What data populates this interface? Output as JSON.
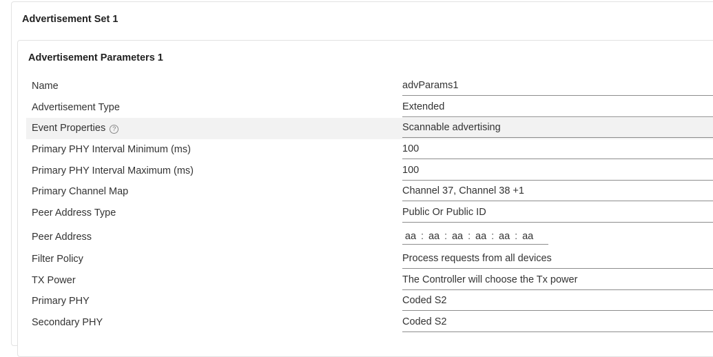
{
  "advertisement_set": {
    "title": "Advertisement Set 1",
    "params_panel": {
      "title": "Advertisement Parameters 1",
      "fields": [
        {
          "label": "Name",
          "value": "advParams1"
        },
        {
          "label": "Advertisement Type",
          "value": "Extended"
        },
        {
          "label": "Event Properties",
          "value": "Scannable advertising",
          "help_icon": "help-circle-icon",
          "highlighted": true
        },
        {
          "label": "Primary PHY Interval Minimum (ms)",
          "value": "100"
        },
        {
          "label": "Primary PHY Interval Maximum (ms)",
          "value": "100"
        },
        {
          "label": "Primary Channel Map",
          "value": "Channel 37, Channel 38 +1"
        },
        {
          "label": "Peer Address Type",
          "value": "Public Or Public ID"
        },
        {
          "label": "Peer Address",
          "octets": [
            "aa",
            "aa",
            "aa",
            "aa",
            "aa",
            "aa"
          ],
          "separator": ":"
        },
        {
          "label": "Filter Policy",
          "value": "Process requests from all devices"
        },
        {
          "label": "TX Power",
          "value": "The Controller will choose the Tx power"
        },
        {
          "label": "Primary PHY",
          "value": "Coded S2"
        },
        {
          "label": "Secondary PHY",
          "value": "Coded S2"
        }
      ]
    }
  },
  "colors": {
    "highlight_row": "#f2f2f2",
    "underline": "#8c8c8c",
    "panel_border": "#e2e2e2"
  }
}
